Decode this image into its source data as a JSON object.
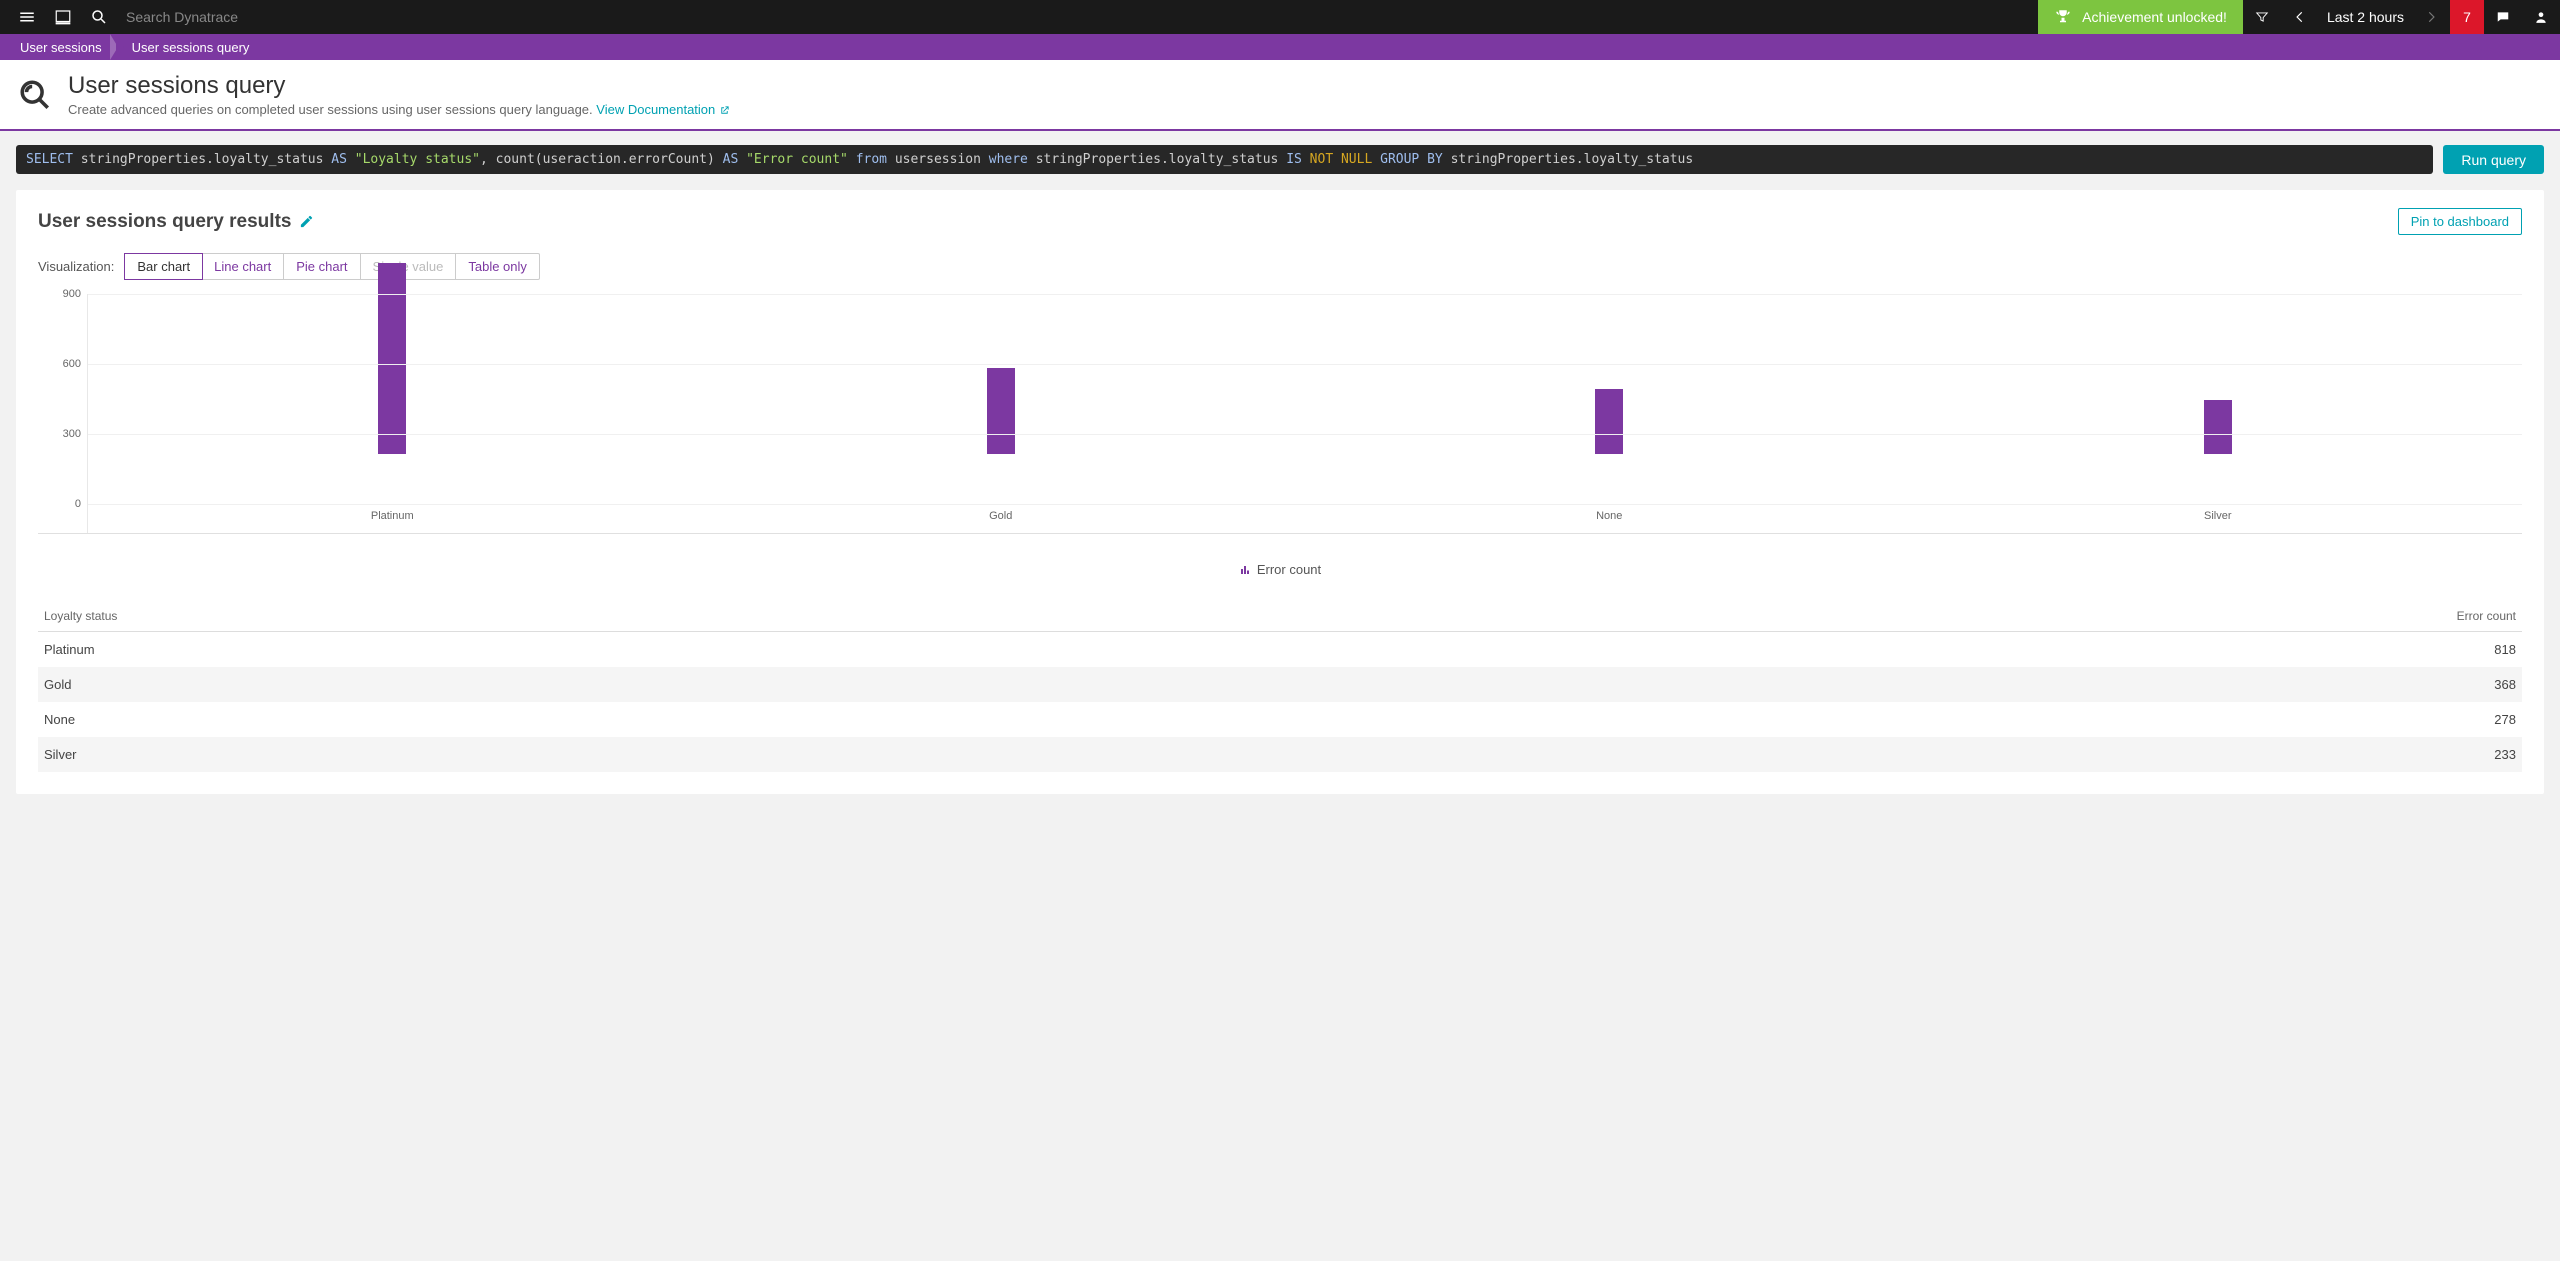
{
  "topnav": {
    "search_placeholder": "Search Dynatrace",
    "achievement": "Achievement unlocked!",
    "time_range": "Last 2 hours",
    "problems": "7"
  },
  "breadcrumbs": [
    "User sessions",
    "User sessions query"
  ],
  "page": {
    "title": "User sessions query",
    "subtitle": "Create advanced queries on completed user sessions using user sessions query language. ",
    "doc_link": "View Documentation"
  },
  "query": {
    "select": "SELECT",
    "fields1": "stringProperties.loyalty_status",
    "as": "AS",
    "alias1": "\"Loyalty status\"",
    "count": "count",
    "count_arg": "(useraction.errorCount)",
    "alias2": "\"Error count\"",
    "from": "from",
    "table": "usersession",
    "where": "where",
    "cond1": "stringProperties.loyalty_status",
    "is": "IS",
    "not": "NOT",
    "null": "NULL",
    "groupby": "GROUP BY",
    "group_field": "stringProperties.loyalty_status",
    "run_label": "Run query"
  },
  "results": {
    "title": "User sessions query results",
    "pin_label": "Pin to dashboard",
    "viz_label": "Visualization:",
    "viz_tabs": [
      "Bar chart",
      "Line chart",
      "Pie chart",
      "Single value",
      "Table only"
    ],
    "legend": "Error count",
    "table_headers": [
      "Loyalty status",
      "Error count"
    ]
  },
  "chart_data": {
    "type": "bar",
    "categories": [
      "Platinum",
      "Gold",
      "None",
      "Silver"
    ],
    "values": [
      818,
      368,
      278,
      233
    ],
    "title": "",
    "xlabel": "",
    "ylabel": "",
    "ylim": [
      0,
      900
    ],
    "y_ticks": [
      0,
      300,
      600,
      900
    ],
    "legend": "Error count",
    "color": "#7c38a1"
  },
  "table_rows": [
    {
      "loyalty": "Platinum",
      "count": 818
    },
    {
      "loyalty": "Gold",
      "count": 368
    },
    {
      "loyalty": "None",
      "count": 278
    },
    {
      "loyalty": "Silver",
      "count": 233
    }
  ]
}
